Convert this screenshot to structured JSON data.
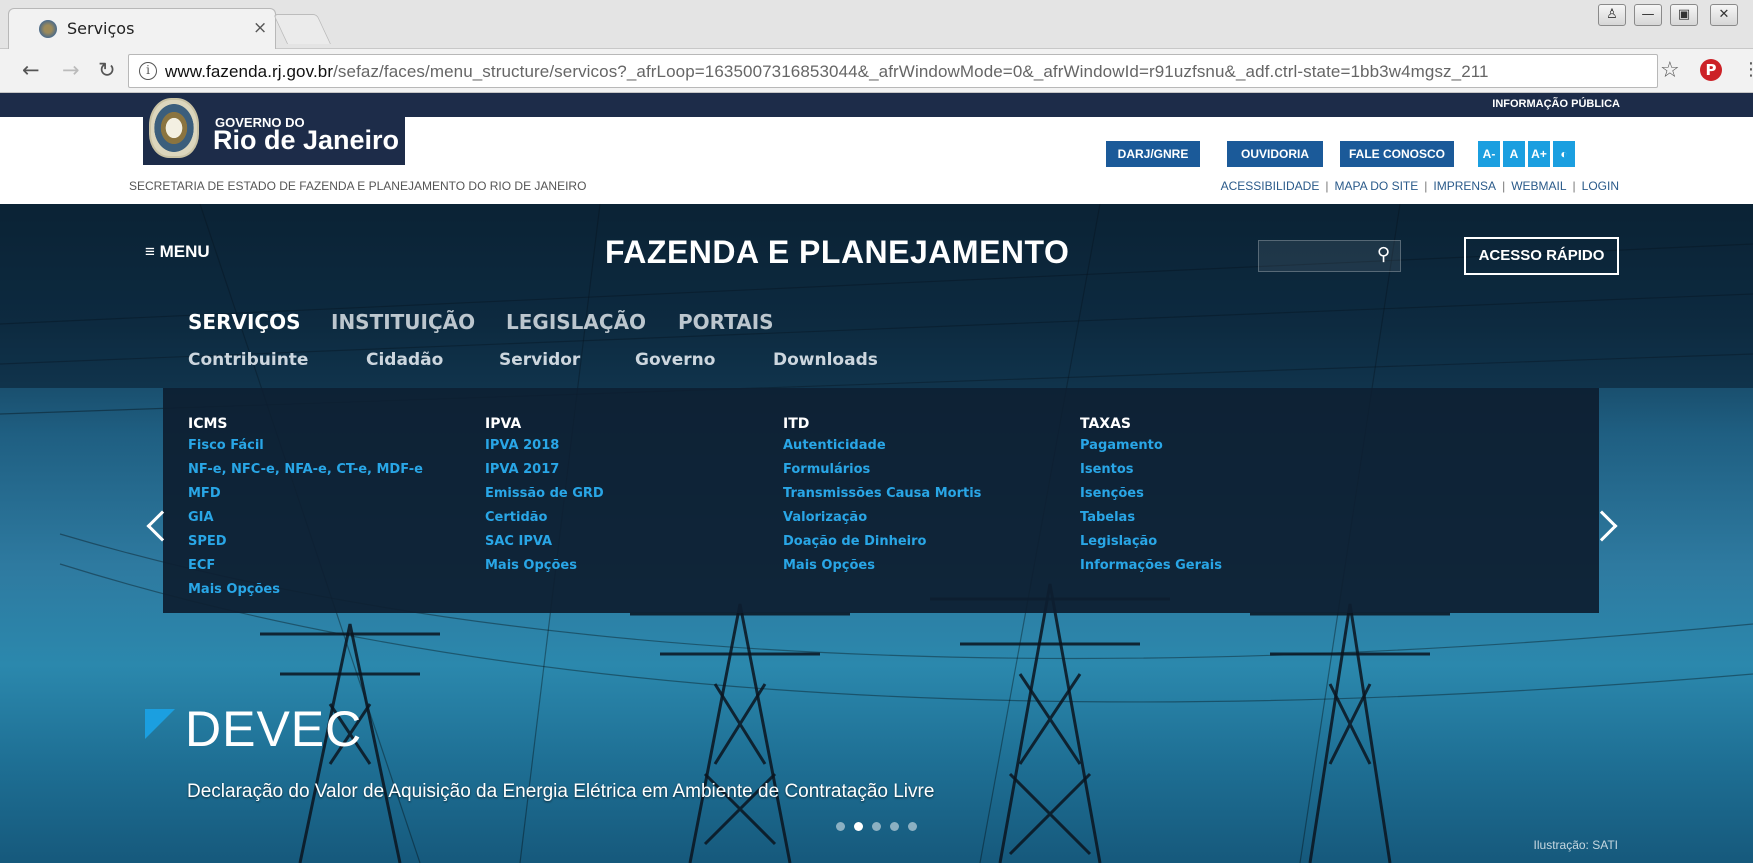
{
  "browser": {
    "tab_title": "Serviços",
    "url_host": "www.fazenda.rj.gov.br",
    "url_path": "/sefaz/faces/menu_structure/servicos?_afrLoop=1635007316853044&_afrWindowMode=0&_afrWindowId=r91uzfsnu&_adf.ctrl-state=1bb3w4mgsz_211",
    "close_glyph": "×"
  },
  "header": {
    "info_publica": "INFORMAÇÃO PÚBLICA",
    "logo_small": "GOVERNO DO",
    "logo_big": "Rio de Janeiro",
    "secretaria": "SECRETARIA DE ESTADO DE FAZENDA E PLANEJAMENTO DO RIO DE JANEIRO",
    "buttons": [
      "DARJ/GNRE",
      "OUVIDORIA",
      "FALE CONOSCO"
    ],
    "font_buttons": [
      "A-",
      "A",
      "A+"
    ],
    "links": [
      "ACESSIBILIDADE",
      "MAPA DO SITE",
      "IMPRENSA",
      "WEBMAIL",
      "LOGIN"
    ]
  },
  "nav": {
    "menu_label": "≡ MENU",
    "site_title": "FAZENDA E PLANEJAMENTO",
    "acesso_rapido": "ACESSO RÁPIDO",
    "main": [
      "SERVIÇOS",
      "INSTITUIÇÃO",
      "LEGISLAÇÃO",
      "PORTAIS"
    ],
    "active_main": "SERVIÇOS",
    "sub": [
      "Contribuinte",
      "Cidadão",
      "Servidor",
      "Governo",
      "Downloads"
    ]
  },
  "dropdown": {
    "columns": [
      {
        "heading": "ICMS",
        "items": [
          "Fisco Fácil",
          "NF-e, NFC-e, NFA-e, CT-e, MDF-e",
          "MFD",
          "GIA",
          "SPED",
          "ECF",
          "Mais Opções"
        ]
      },
      {
        "heading": "IPVA",
        "items": [
          "IPVA 2018",
          "IPVA 2017",
          "Emissão de GRD",
          "Certidão",
          "SAC IPVA",
          "Mais Opções"
        ]
      },
      {
        "heading": "ITD",
        "items": [
          "Autenticidade",
          "Formulários",
          "Transmissões Causa Mortis",
          "Valorização",
          "Doação de Dinheiro",
          "Mais Opções"
        ]
      },
      {
        "heading": "TAXAS",
        "items": [
          "Pagamento",
          "Isentos",
          "Isenções",
          "Tabelas",
          "Legislação",
          "Informações Gerais"
        ]
      }
    ]
  },
  "slide": {
    "title": "DEVEC",
    "subtitle": "Declaração do Valor de Aquisição da Energia Elétrica em Ambiente de Contratação Livre",
    "credit": "Ilustração: SATI",
    "dot_count": 5,
    "active_dot": 1
  },
  "colors": {
    "header_navy": "#1d2c49",
    "button_blue": "#1b5a99",
    "accent_cyan": "#1b9fe0",
    "menu_link": "#29a6e6"
  },
  "icons": [
    "favicon-seal-icon",
    "back-arrow-icon",
    "forward-arrow-icon",
    "reload-icon",
    "info-icon",
    "star-icon",
    "pinterest-icon",
    "menu-kebab-icon",
    "search-icon",
    "contrast-icon",
    "chevron-left-icon",
    "chevron-right-icon"
  ]
}
